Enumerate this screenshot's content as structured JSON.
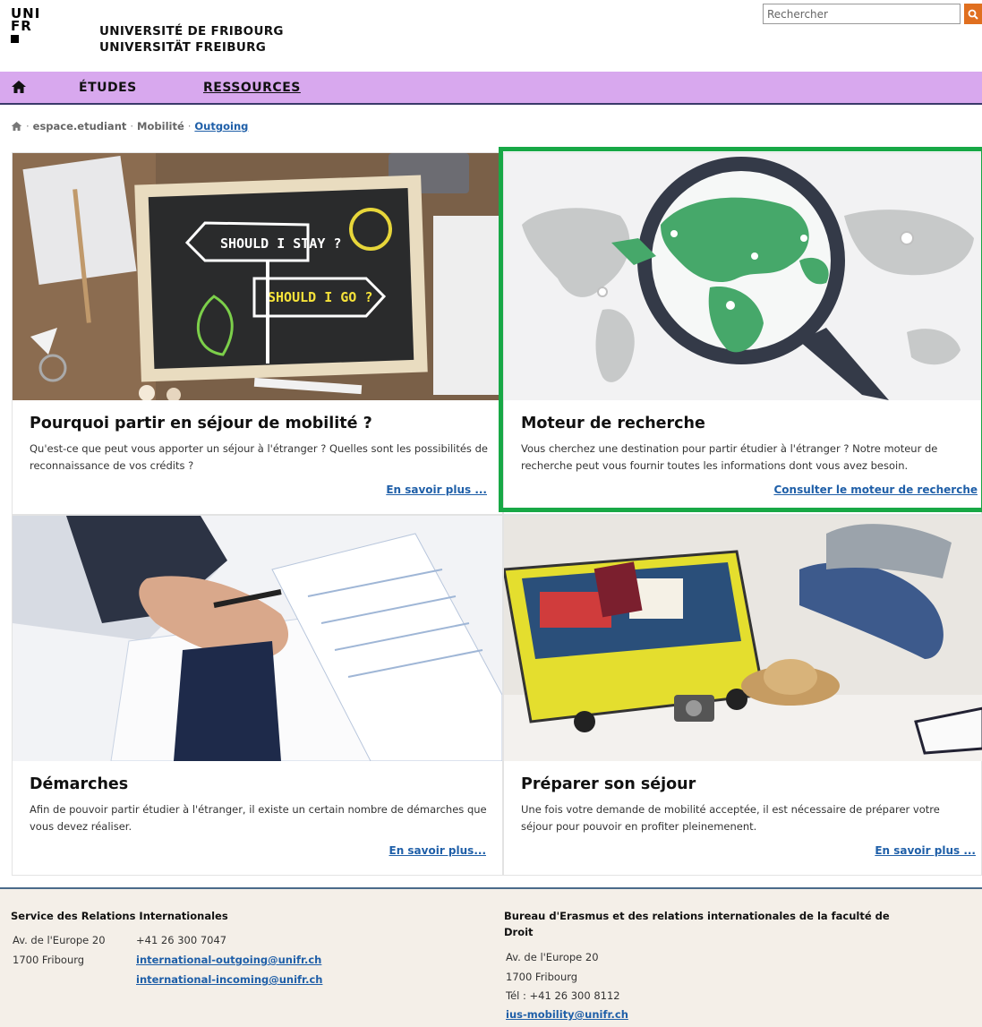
{
  "header": {
    "logo_line1": "UNI",
    "logo_line2": "FR",
    "name_fr": "UNIVERSITÉ DE FRIBOURG",
    "name_de": "UNIVERSITÄT FREIBURG",
    "search_placeholder": "Rechercher"
  },
  "nav": {
    "items": [
      {
        "label": "ÉTUDES"
      },
      {
        "label": "RESSOURCES"
      }
    ]
  },
  "breadcrumb": {
    "items": [
      "espace.etudiant",
      "Mobilité"
    ],
    "current": "Outgoing"
  },
  "cards": [
    {
      "title": "Pourquoi partir en séjour de mobilité ?",
      "text": "Qu'est-ce que peut vous apporter un séjour à l'étranger ? Quelles sont les possibilités de reconnaissance de vos crédits ?",
      "link": "En savoir plus ...",
      "img_sign1": "SHOULD I STAY ?",
      "img_sign2": "SHOULD I GO ?"
    },
    {
      "title": "Moteur de recherche",
      "text": "Vous cherchez une destination pour partir étudier à l'étranger ? Notre moteur de recherche peut vous fournir toutes les informations dont vous avez besoin.",
      "link": "Consulter le moteur de recherche"
    },
    {
      "title": "Démarches",
      "text": "Afin de pouvoir partir étudier à l'étranger, il existe un certain nombre de démarches que vous devez réaliser.",
      "link": "En savoir plus..."
    },
    {
      "title": "Préparer son séjour",
      "text": "Une fois votre demande de mobilité acceptée, il est nécessaire de préparer votre séjour pour pouvoir en profiter pleinemenent.",
      "link": "En savoir plus ..."
    }
  ],
  "footer": {
    "left": {
      "title": "Service des Relations Internationales",
      "addr1": "Av. de l'Europe 20",
      "addr2": "1700 Fribourg",
      "phone": "+41 26 300 7047",
      "email1": "international-outgoing@unifr.ch",
      "email2": "international-incoming@unifr.ch"
    },
    "right": {
      "title_line1": "Bureau d'Erasmus et des relations internationales de la faculté de",
      "title_line2": "Droit",
      "addr1": "Av. de l'Europe 20",
      "addr2": "1700 Fribourg",
      "phone": "Tél : +41 26 300 8112",
      "email": "ius-mobility@unifr.ch"
    }
  },
  "colors": {
    "nav_bg": "#d8a8ee",
    "link": "#1f5fa8",
    "highlight": "#18a846",
    "search_btn": "#e06f1f"
  }
}
